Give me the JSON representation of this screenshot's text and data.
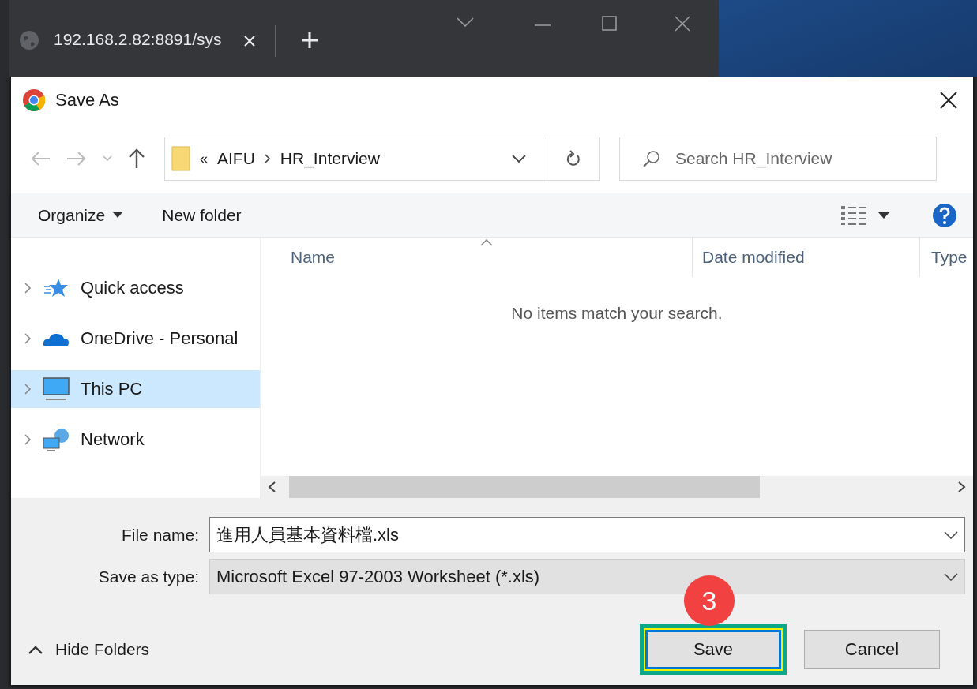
{
  "browser": {
    "tab_title": "192.168.2.82:8891/sys"
  },
  "dialog": {
    "title": "Save As"
  },
  "address": {
    "overflow": "«",
    "crumbs": [
      {
        "label": "AIFU"
      },
      {
        "label": "HR_Interview"
      }
    ]
  },
  "search": {
    "placeholder": "Search HR_Interview"
  },
  "toolbar": {
    "organize": "Organize",
    "new_folder": "New folder"
  },
  "nav": [
    {
      "label": "Quick access",
      "kind": "star",
      "selected": false
    },
    {
      "label": "OneDrive - Personal",
      "kind": "cloud",
      "selected": false
    },
    {
      "label": "This PC",
      "kind": "pc",
      "selected": true
    },
    {
      "label": "Network",
      "kind": "network",
      "selected": false
    }
  ],
  "columns": [
    {
      "label": "Name"
    },
    {
      "label": "Date modified"
    },
    {
      "label": "Type"
    }
  ],
  "empty_message": "No items match your search.",
  "file_name": {
    "label": "File name:",
    "value": "進用人員基本資料檔.xls"
  },
  "save_type": {
    "label": "Save as type:",
    "value": "Microsoft Excel 97-2003 Worksheet (*.xls)"
  },
  "hide_folders": "Hide Folders",
  "buttons": [
    {
      "label": "Save",
      "kind": "default",
      "highlighted": true
    },
    {
      "label": "Cancel",
      "kind": "normal",
      "highlighted": false
    }
  ],
  "annotation": {
    "label": "3"
  }
}
